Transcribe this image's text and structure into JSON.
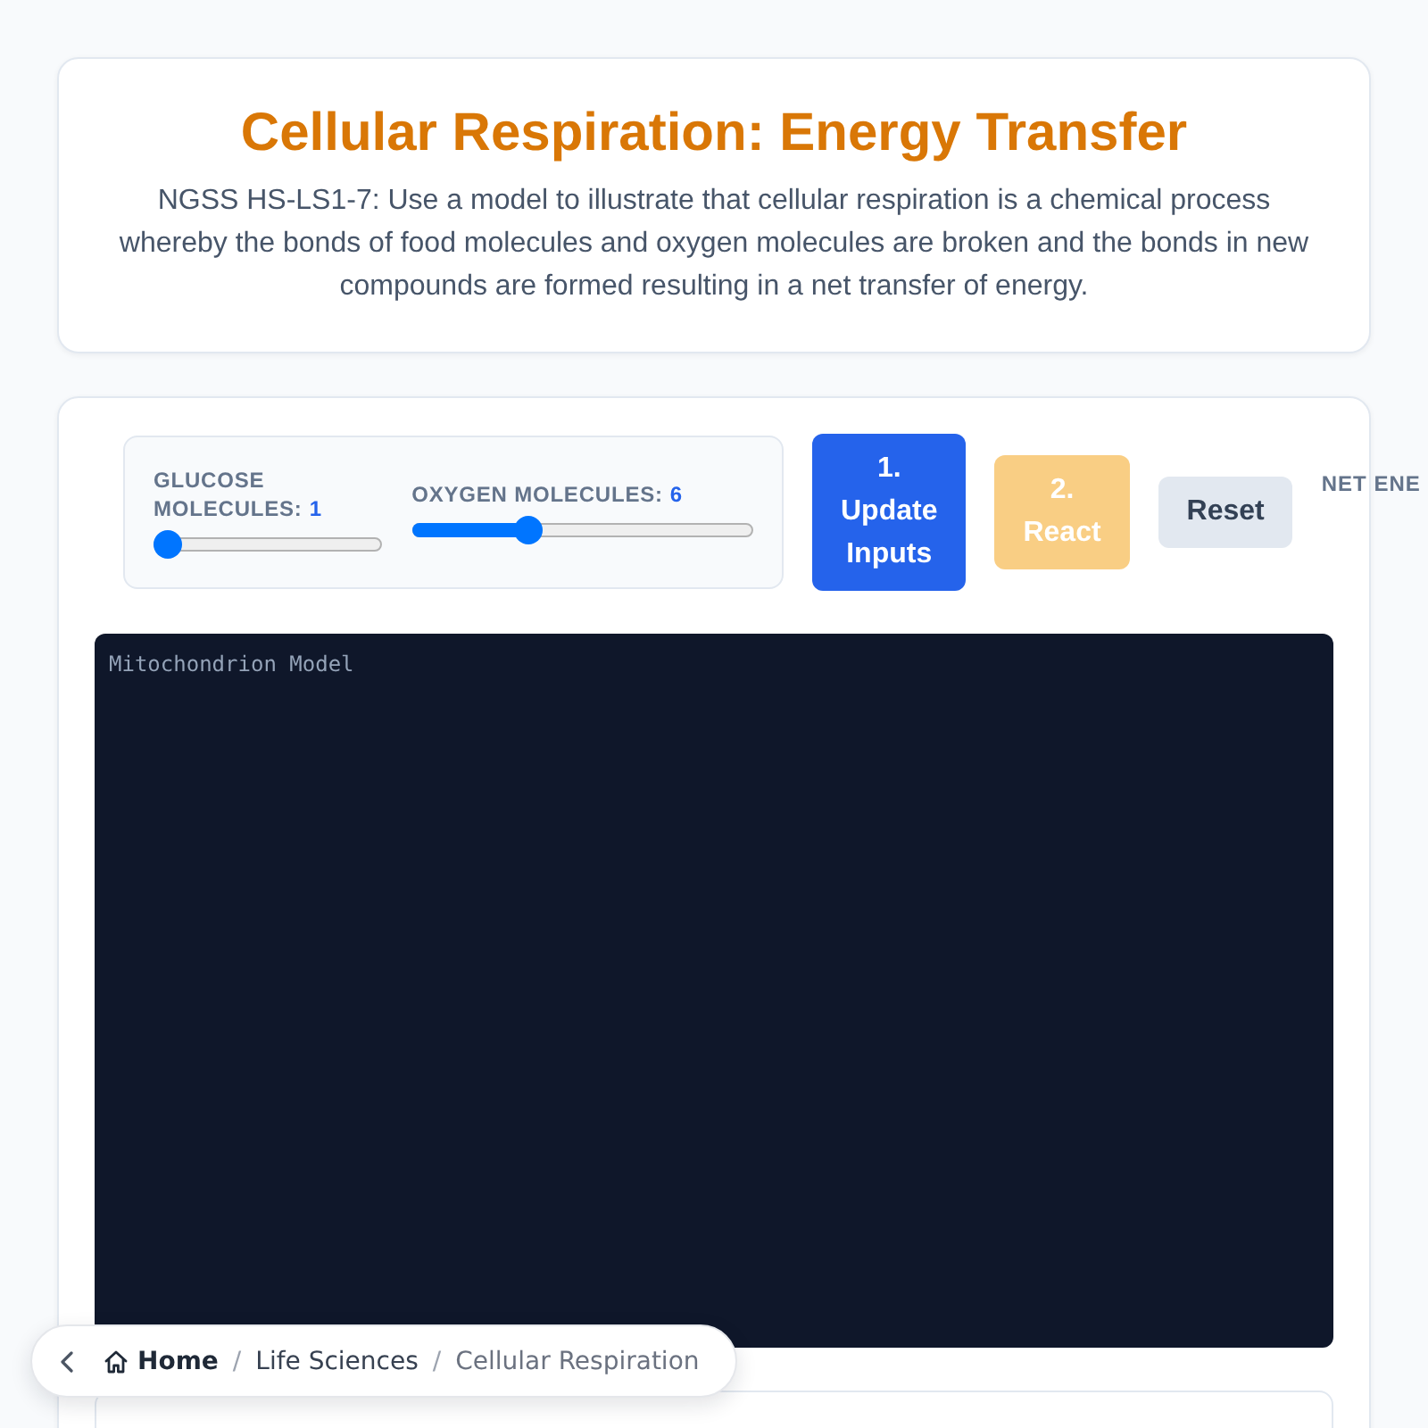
{
  "header": {
    "title": "Cellular Respiration: Energy Transfer",
    "description": "NGSS HS-LS1-7: Use a model to illustrate that cellular respiration is a chemical process whereby the bonds of food molecules and oxygen molecules are broken and the bonds in new compounds are formed resulting in a net transfer of energy."
  },
  "controls": {
    "sliders": [
      {
        "label": "GLUCOSE MOLECULES:",
        "value": "1",
        "level": 0
      },
      {
        "label": "OXYGEN MOLECULES:",
        "value": "6",
        "level": 0.33
      }
    ],
    "buttons": [
      {
        "label": "1. Update Inputs",
        "kind": "primary",
        "disabled": false
      },
      {
        "label": "2. React",
        "kind": "warning",
        "disabled": true
      },
      {
        "label": "Reset",
        "kind": "secondary",
        "disabled": false
      }
    ],
    "stat_label": "NET ENE"
  },
  "model": {
    "label": "Mitochondrion Model"
  },
  "breadcrumb": {
    "items": [
      {
        "label": "Home",
        "kind": "home"
      },
      {
        "label": "Life Sciences",
        "kind": "link",
        "separator": "/"
      },
      {
        "label": "Cellular Respiration",
        "kind": "current",
        "separator": "/"
      }
    ]
  }
}
